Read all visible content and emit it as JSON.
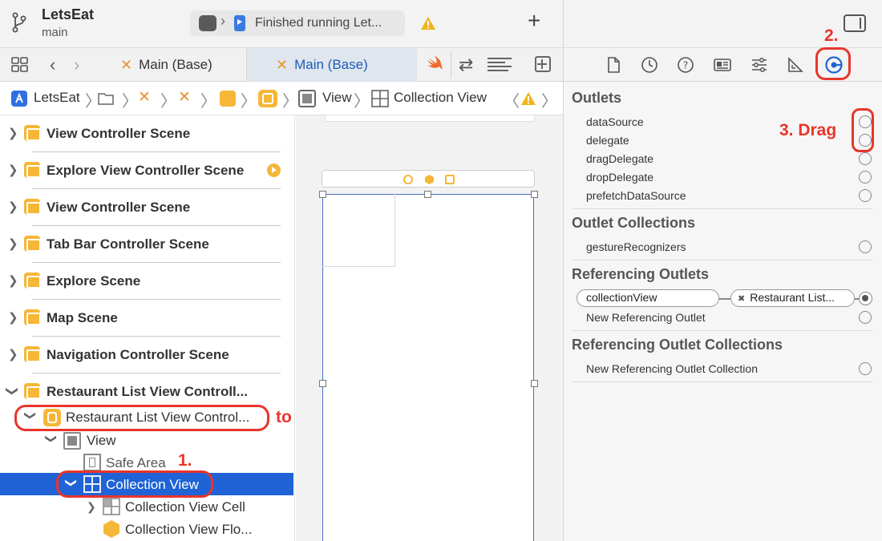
{
  "window": {
    "project_name": "LetsEat",
    "branch": "main",
    "status": "Finished running Let..."
  },
  "tabs": [
    {
      "label": "Main (Base)",
      "active": false
    },
    {
      "label": "Main (Base)",
      "active": true
    }
  ],
  "jumpbar": {
    "project": "LetsEat",
    "view": "View",
    "collection_view": "Collection View"
  },
  "outline": {
    "scenes": [
      {
        "label": "View Controller Scene",
        "expanded": false
      },
      {
        "label": "Explore View Controller Scene",
        "expanded": false
      },
      {
        "label": "View Controller Scene",
        "expanded": false
      },
      {
        "label": "Tab Bar Controller Scene",
        "expanded": false
      },
      {
        "label": "Explore Scene",
        "expanded": false
      },
      {
        "label": "Map Scene",
        "expanded": false
      },
      {
        "label": "Navigation Controller Scene",
        "expanded": false
      },
      {
        "label": "Restaurant List View Controll...",
        "expanded": true
      }
    ],
    "tree": {
      "controller": "Restaurant List View Control...",
      "view": "View",
      "safe_area": "Safe Area",
      "collection_view": "Collection View",
      "cell": "Collection View Cell",
      "flow_layout": "Collection View Flo..."
    }
  },
  "annotations": {
    "step1": "1.",
    "step2": "2.",
    "step3": "3. Drag",
    "target": "to here"
  },
  "inspector": {
    "sections": {
      "outlets": "Outlets",
      "outlet_collections": "Outlet Collections",
      "referencing_outlets": "Referencing Outlets",
      "referencing_outlet_collections": "Referencing Outlet Collections"
    },
    "outlets": [
      "dataSource",
      "delegate",
      "dragDelegate",
      "dropDelegate",
      "prefetchDataSource"
    ],
    "outlet_collections": [
      "gestureRecognizers"
    ],
    "referencing": {
      "outlet_name": "collectionView",
      "target": "Restaurant List...",
      "new_outlet": "New Referencing Outlet"
    },
    "new_outlet_collection": "New Referencing Outlet Collection"
  },
  "colors": {
    "accent": "#1f63d6",
    "annotation": "#e8352b",
    "scene_icon": "#f6b636",
    "xib_icon": "#e8942a"
  }
}
